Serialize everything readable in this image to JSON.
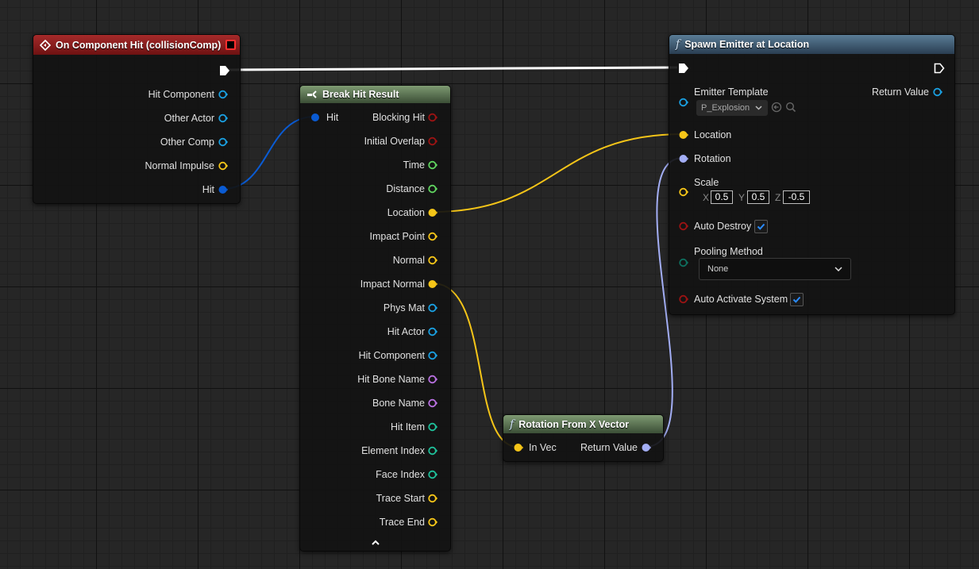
{
  "on_hit_node": {
    "title": "On Component Hit (collisionComp)",
    "pins": [
      "Hit Component",
      "Other Actor",
      "Other Comp",
      "Normal Impulse",
      "Hit"
    ]
  },
  "break_node": {
    "title": "Break Hit Result",
    "input_pin": "Hit",
    "pins": [
      "Blocking Hit",
      "Initial Overlap",
      "Time",
      "Distance",
      "Location",
      "Impact Point",
      "Normal",
      "Impact Normal",
      "Phys Mat",
      "Hit Actor",
      "Hit Component",
      "Hit Bone Name",
      "Bone Name",
      "Hit Item",
      "Element Index",
      "Face Index",
      "Trace Start",
      "Trace End"
    ]
  },
  "spawn_node": {
    "title": "Spawn Emitter at Location",
    "emitter_template_label": "Emitter Template",
    "emitter_template_value": "P_Explosion",
    "return_value": "Return Value",
    "location": "Location",
    "rotation": "Rotation",
    "scale": "Scale",
    "scale_x_label": "X",
    "scale_x": "0.5",
    "scale_y_label": "Y",
    "scale_y": "0.5",
    "scale_z_label": "Z",
    "scale_z": "-0.5",
    "auto_destroy": "Auto Destroy",
    "auto_destroy_checked": true,
    "pooling_method_label": "Pooling Method",
    "pooling_method_value": "None",
    "auto_activate": "Auto Activate System",
    "auto_activate_checked": true
  },
  "rot_node": {
    "title": "Rotation From X Vector",
    "in_pin": "In Vec",
    "return_value": "Return Value"
  },
  "colors": {
    "exec": "#ffffff",
    "object": "#1a9fe0",
    "struct": "#0a5bd3",
    "vector": "#f5c518",
    "rotator": "#a3aef5",
    "bool": "#9b1313",
    "float": "#5fd35f",
    "int": "#1fbf99",
    "name": "#b870e0",
    "byte": "#0e6e5e"
  }
}
